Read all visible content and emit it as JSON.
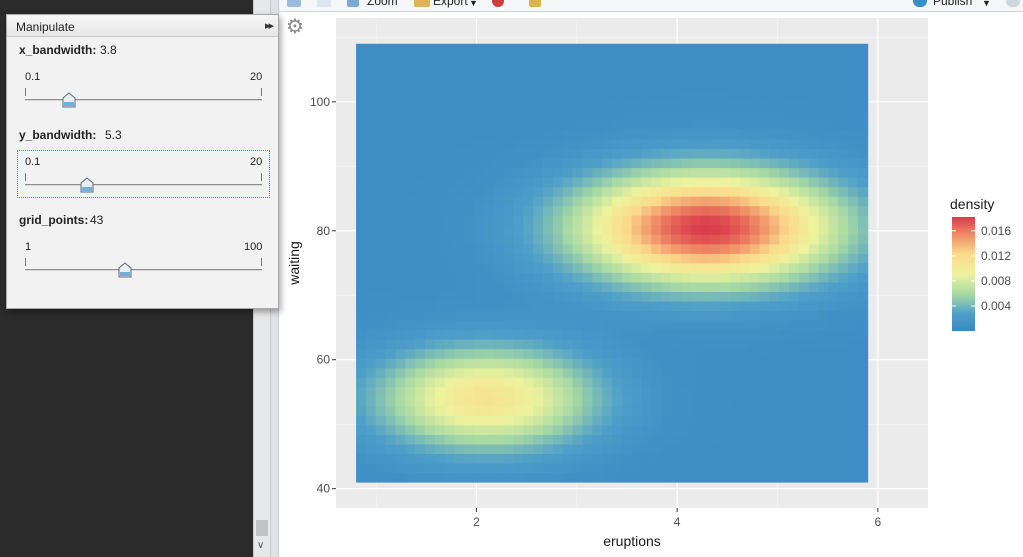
{
  "toolbar": {
    "zoom_label": "Zoom",
    "export_label": "Export",
    "publish_label": "Publish"
  },
  "manipulate": {
    "title": "Manipulate",
    "controls": [
      {
        "label": "x_bandwidth:",
        "value": "3.8",
        "min": "0.1",
        "max": "20",
        "fraction": 0.186
      },
      {
        "label": "y_bandwidth:",
        "value": "5.3",
        "min": "0.1",
        "max": "20",
        "fraction": 0.261
      },
      {
        "label": "grid_points:",
        "value": "43",
        "min": "1",
        "max": "100",
        "fraction": 0.424
      }
    ]
  },
  "colors": {
    "low": "#3a88c4",
    "mid_low": "#a6d9a4",
    "mid": "#eef39d",
    "mid_high": "#fbd98b",
    "high": "#d9394a"
  },
  "chart_data": {
    "type": "heatmap",
    "xlabel": "eruptions",
    "ylabel": "waiting",
    "x_ticks": [
      "2",
      "4",
      "6"
    ],
    "y_ticks": [
      "40",
      "60",
      "80",
      "100"
    ],
    "xlim": [
      0.6,
      6.5
    ],
    "ylim": [
      37,
      113
    ],
    "data_extent": {
      "x": [
        0.8,
        5.9
      ],
      "y": [
        41,
        109
      ]
    },
    "grid": true,
    "legend": {
      "title": "density",
      "position": "right",
      "breaks": [
        "0.016",
        "0.012",
        "0.008",
        "0.004"
      ],
      "break_values": [
        0.016,
        0.012,
        0.008,
        0.004
      ],
      "range": [
        0.0,
        0.0182
      ]
    },
    "peaks": [
      {
        "x": 4.3,
        "y": 80.5,
        "density": 0.0175,
        "sx": 0.9,
        "sy": 6.0
      },
      {
        "x": 2.1,
        "y": 54.0,
        "density": 0.0105,
        "sx": 0.75,
        "sy": 5.5
      }
    ]
  }
}
